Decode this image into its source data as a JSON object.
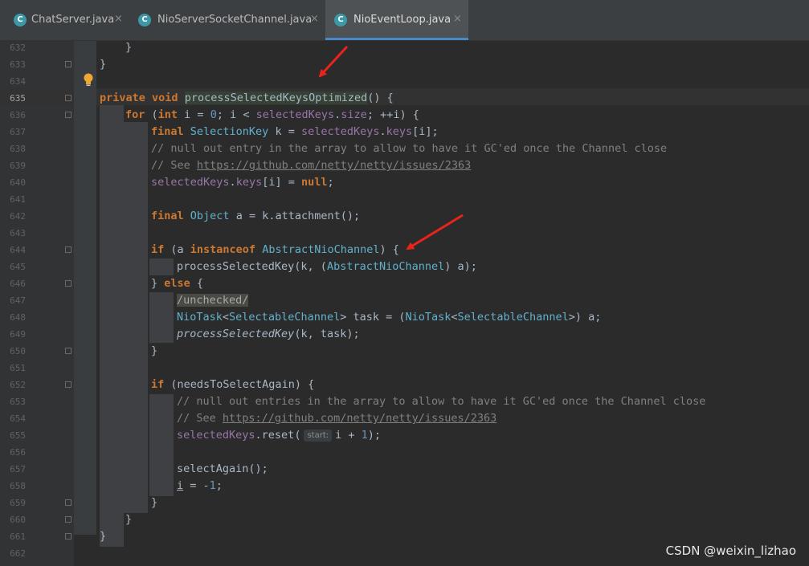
{
  "tabs": [
    {
      "label": "ChatServer.java",
      "icon": "java-class-icon",
      "close": "×",
      "active": false
    },
    {
      "label": "NioServerSocketChannel.java",
      "icon": "java-class-icon",
      "close": "×",
      "active": false
    },
    {
      "label": "NioEventLoop.java",
      "icon": "java-class-icon",
      "close": "×",
      "active": true
    }
  ],
  "tab_icon_glyph": "C",
  "editor": {
    "current_line": "635",
    "lines": [
      {
        "num": "632"
      },
      {
        "num": "633"
      },
      {
        "num": "634"
      },
      {
        "num": "635"
      },
      {
        "num": "636"
      },
      {
        "num": "637"
      },
      {
        "num": "638"
      },
      {
        "num": "639"
      },
      {
        "num": "640"
      },
      {
        "num": "641"
      },
      {
        "num": "642"
      },
      {
        "num": "643"
      },
      {
        "num": "644"
      },
      {
        "num": "645"
      },
      {
        "num": "646"
      },
      {
        "num": "647"
      },
      {
        "num": "648"
      },
      {
        "num": "649"
      },
      {
        "num": "650"
      },
      {
        "num": "651"
      },
      {
        "num": "652"
      },
      {
        "num": "653"
      },
      {
        "num": "654"
      },
      {
        "num": "655"
      },
      {
        "num": "656"
      },
      {
        "num": "657"
      },
      {
        "num": "658"
      },
      {
        "num": "659"
      },
      {
        "num": "660"
      },
      {
        "num": "661"
      },
      {
        "num": "662"
      }
    ],
    "hint_label": "start:"
  },
  "watermark": "CSDN @weixin_lizhao",
  "colors": {
    "background": "#2b2b2b",
    "keyword": "#cc7832",
    "field": "#9876aa",
    "type": "#62b1cc",
    "number": "#6897bb",
    "comment": "#808080",
    "arrow": "#e8241c",
    "active_tab_underline": "#4a88c7"
  }
}
